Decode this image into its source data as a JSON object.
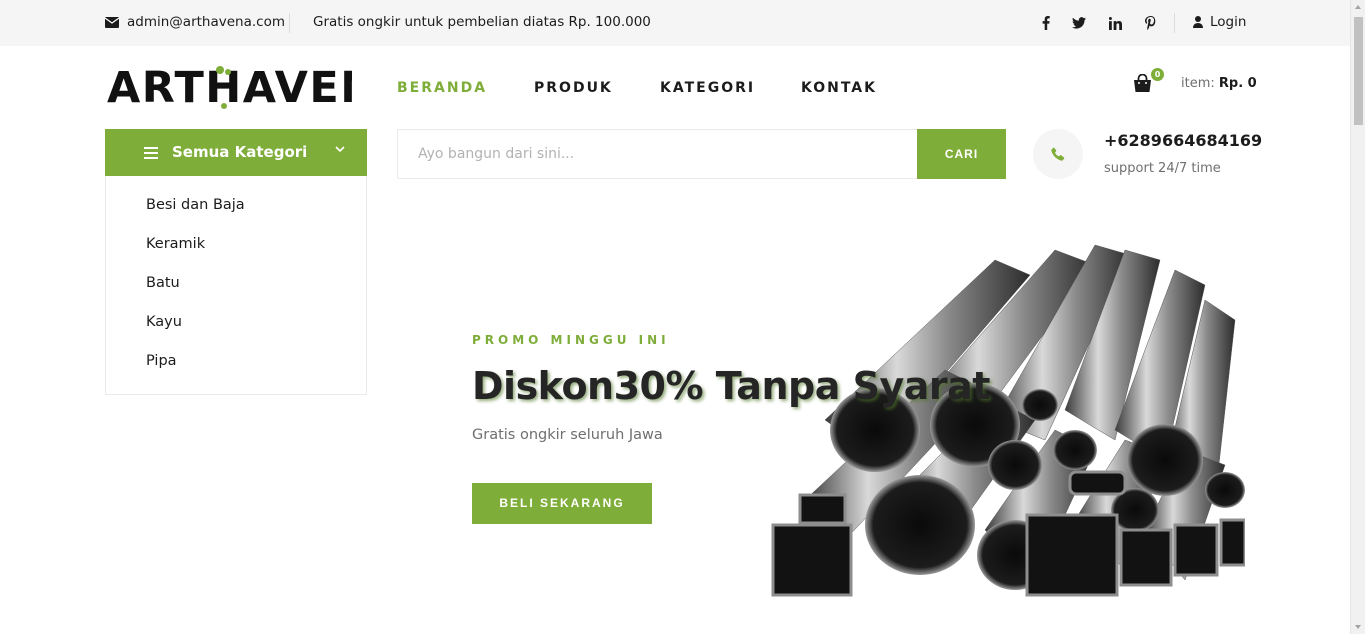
{
  "topbar": {
    "email": "admin@arthavena.com",
    "promo": "Gratis ongkir untuk pembelian diatas Rp. 100.000",
    "social": [
      "facebook-icon",
      "twitter-icon",
      "linkedin-icon",
      "pinterest-icon"
    ],
    "login": "Login"
  },
  "header": {
    "logo": "ARTHAVENA",
    "nav": [
      "BERANDA",
      "PRODUK",
      "KATEGORI",
      "KONTAK"
    ],
    "cart_count": "0",
    "cart_item_label": "item:",
    "cart_total": "Rp. 0"
  },
  "categories": {
    "title": "Semua Kategori",
    "items": [
      "Besi dan Baja",
      "Keramik",
      "Batu",
      "Kayu",
      "Pipa"
    ]
  },
  "search": {
    "placeholder": "Ayo bangun dari sini...",
    "button": "CARI"
  },
  "contact": {
    "phone": "+6289664684169",
    "support": "support 24/7 time"
  },
  "hero": {
    "kicker": "PROMO MINGGU INI",
    "title": "Diskon30% Tanpa Syarat",
    "subtitle": "Gratis ongkir seluruh Jawa",
    "button": "BELI SEKARANG"
  },
  "colors": {
    "accent": "#7fad39",
    "topbar_bg": "#f5f5f5",
    "text": "#1c1c1c"
  }
}
